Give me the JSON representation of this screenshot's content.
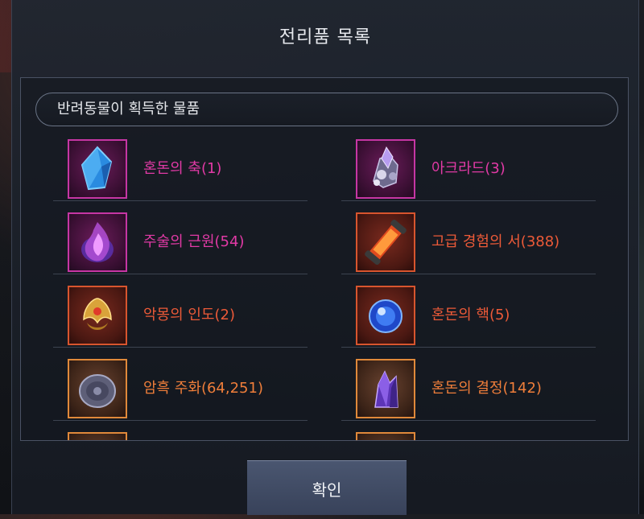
{
  "window": {
    "title": "전리품 목록"
  },
  "panel": {
    "header": "반려동물이 획득한 물품"
  },
  "items": [
    {
      "label": "혼돈의 축(1)",
      "rarity": "epic",
      "icon": "blue-crystal-shard-icon"
    },
    {
      "label": "아크라드(3)",
      "rarity": "epic",
      "icon": "ore-cluster-icon"
    },
    {
      "label": "주술의 근원(54)",
      "rarity": "epic",
      "icon": "purple-flame-icon"
    },
    {
      "label": "고급 경험의 서(388)",
      "rarity": "rare",
      "icon": "scroll-icon"
    },
    {
      "label": "악몽의 인도(2)",
      "rarity": "rare",
      "icon": "gold-emblem-icon"
    },
    {
      "label": "혼돈의 핵(5)",
      "rarity": "rare",
      "icon": "blue-orb-icon"
    },
    {
      "label": "암흑 주화(64,251)",
      "rarity": "unique",
      "icon": "dark-coin-icon"
    },
    {
      "label": "혼돈의 결정(142)",
      "rarity": "unique",
      "icon": "purple-crystal-icon"
    }
  ],
  "footer": {
    "confirm_label": "확인"
  },
  "colors": {
    "epic": "#e23aa6",
    "rare": "#ec5a38",
    "unique": "#ef7e3a",
    "title_text": "#e7e9ee"
  }
}
